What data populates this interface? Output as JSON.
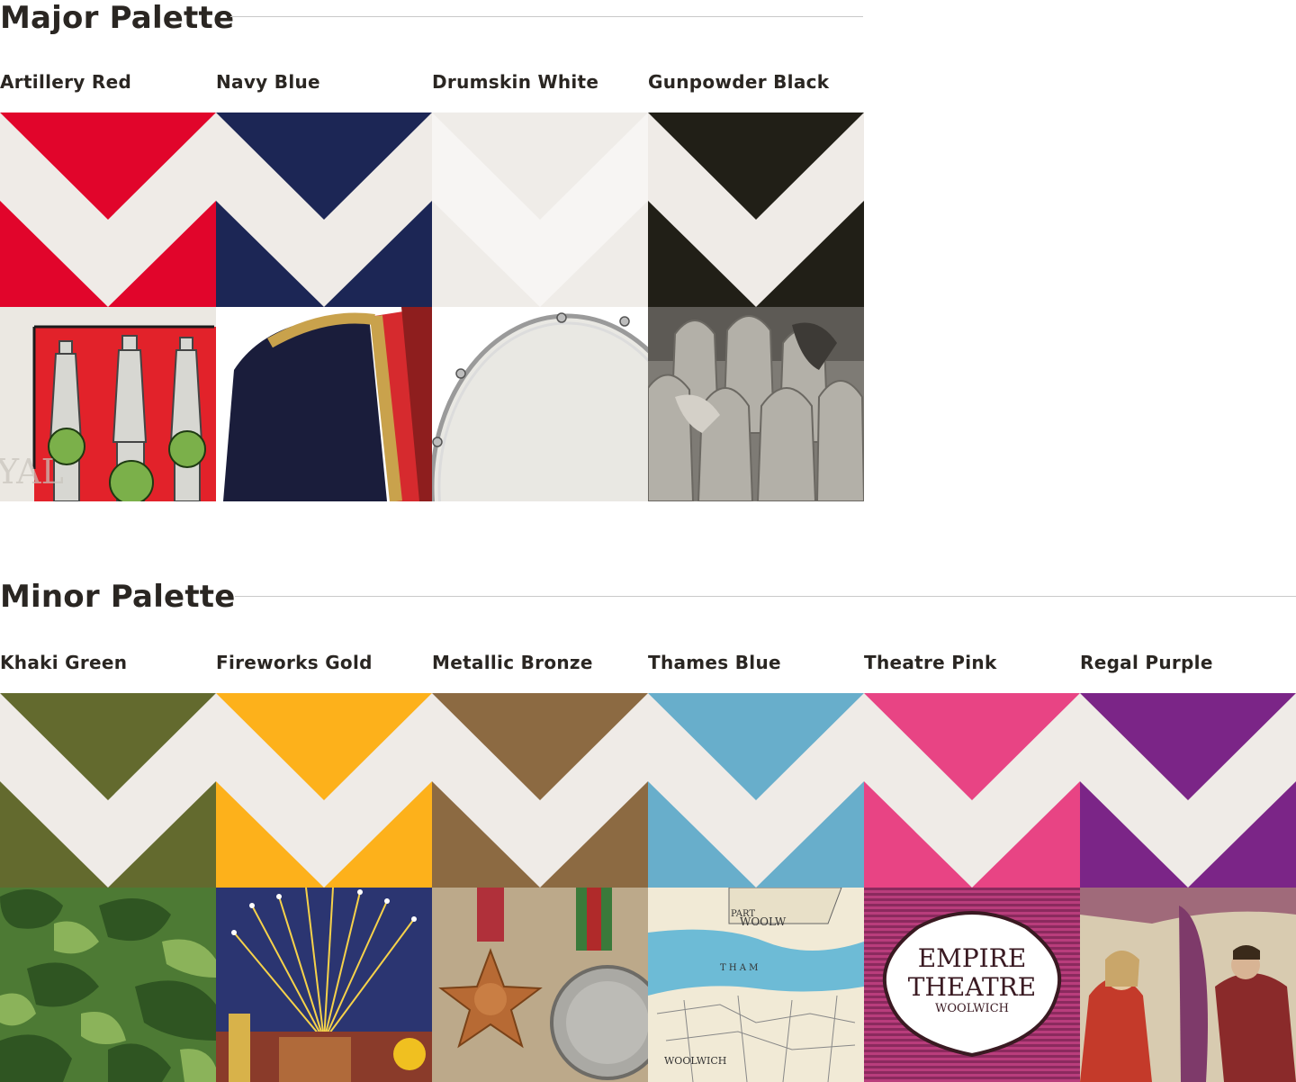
{
  "major": {
    "title": "Major Palette",
    "swatches": [
      {
        "name": "Artillery Red",
        "color": "#e1052b",
        "image": "heraldic-cannon-shield-image"
      },
      {
        "name": "Navy Blue",
        "color": "#1c2655",
        "image": "navy-uniform-jacket-image"
      },
      {
        "name": "Drumskin White",
        "color": "#efece8",
        "image": "drum-skin-image"
      },
      {
        "name": "Gunpowder Black",
        "color": "#211f17",
        "image": "artillery-shells-photo-image"
      }
    ]
  },
  "minor": {
    "title": "Minor Palette",
    "swatches": [
      {
        "name": "Khaki Green",
        "color": "#636a2e",
        "image": "camouflage-image"
      },
      {
        "name": "Fireworks Gold",
        "color": "#fdb11b",
        "image": "fireworks-image"
      },
      {
        "name": "Metallic Bronze",
        "color": "#8c6a42",
        "image": "medals-image"
      },
      {
        "name": "Thames Blue",
        "color": "#68aecb",
        "image": "thames-map-image"
      },
      {
        "name": "Theatre Pink",
        "color": "#e84484",
        "image": "empire-theatre-sign-image"
      },
      {
        "name": "Regal Purple",
        "color": "#7b2587",
        "image": "regal-painting-image"
      }
    ]
  },
  "chevron_color": "#efebe7",
  "logo": {
    "line1": "EMPIRE",
    "line2": "THEATRE",
    "line3": "WOOLWICH"
  },
  "map_labels": {
    "top1": "PART",
    "top2": "WOOLW",
    "river": "T H A M",
    "bottom": "WOOLWICH"
  }
}
